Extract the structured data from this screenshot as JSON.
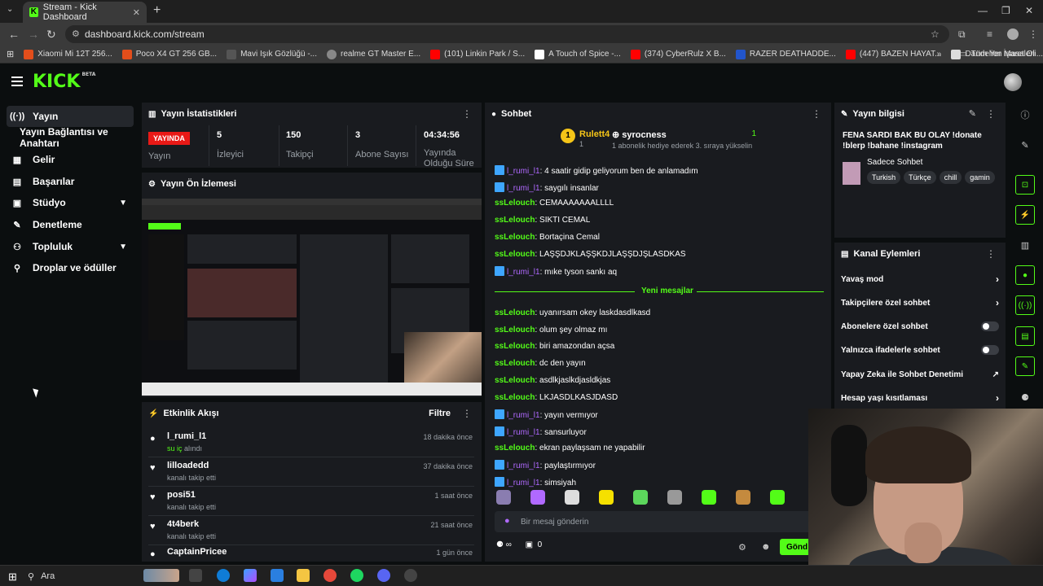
{
  "browser": {
    "tab_title": "Stream - Kick Dashboard",
    "url": "dashboard.kick.com/stream",
    "bookmarks": [
      {
        "label": "Xiaomi Mi 12T 256...",
        "color": "#e34e1b"
      },
      {
        "label": "Poco X4 GT 256 GB...",
        "color": "#e34e1b"
      },
      {
        "label": "Mavi Işık Gözlüğü -...",
        "color": "#555555"
      },
      {
        "label": "realme GT Master E...",
        "color": "#888888"
      },
      {
        "label": "(101) Linkin Park / S...",
        "color": "#ff0000"
      },
      {
        "label": "A Touch of Spice -...",
        "color": "#ffffff"
      },
      {
        "label": "(374) CyberRulz X B...",
        "color": "#ff0000"
      },
      {
        "label": "RAZER DEATHADDE...",
        "color": "#2255cc"
      },
      {
        "label": "(447) BAZEN HAYAT...",
        "color": "#ff0000"
      },
      {
        "label": "Dandelion Masa Oli...",
        "color": "#dddddd"
      }
    ],
    "bookmarks_folder": "Tüm Yer İşaretleri"
  },
  "sidebar": {
    "items": [
      {
        "label": "Yayın",
        "icon": "broadcast-icon"
      },
      {
        "label": "Yayın Bağlantısı ve Anahtarı",
        "icon": ""
      },
      {
        "label": "Gelir",
        "icon": "revenue-icon"
      },
      {
        "label": "Başarılar",
        "icon": "achievements-icon"
      },
      {
        "label": "Stüdyo",
        "icon": "studio-icon"
      },
      {
        "label": "Denetleme",
        "icon": "moderation-icon"
      },
      {
        "label": "Topluluk",
        "icon": "community-icon"
      },
      {
        "label": "Droplar ve ödüller",
        "icon": "drops-icon"
      }
    ]
  },
  "stats": {
    "title": "Yayın İstatistikleri",
    "live_label": "YAYINDA",
    "live_sub": "Yayın",
    "viewers": {
      "value": "5",
      "label": "İzleyici"
    },
    "followers": {
      "value": "150",
      "label": "Takipçi"
    },
    "subs": {
      "value": "3",
      "label": "Abone Sayısı"
    },
    "duration": {
      "value": "04:34:56",
      "label": "Yayında Olduğu Süre"
    }
  },
  "preview": {
    "title": "Yayın Ön İzlemesi"
  },
  "activity": {
    "title": "Etkinlik Akışı",
    "filter": "Filtre",
    "items": [
      {
        "name": "l_rumi_l1",
        "desc_green": "su iç",
        "desc": " alındı",
        "time": "18 dakika önce",
        "icon": "reward-icon"
      },
      {
        "name": "lilloadedd",
        "desc_green": "",
        "desc": "kanalı takip etti",
        "time": "37 dakika önce",
        "icon": "heart-icon"
      },
      {
        "name": "posi51",
        "desc_green": "",
        "desc": "kanalı takip etti",
        "time": "1 saat önce",
        "icon": "heart-icon"
      },
      {
        "name": "4t4berk",
        "desc_green": "",
        "desc": "kanalı takip etti",
        "time": "21 saat önce",
        "icon": "heart-icon"
      },
      {
        "name": "CaptainPricee",
        "desc_green": "",
        "desc": "",
        "time": "1 gün önce",
        "icon": "reward-icon"
      }
    ]
  },
  "chat": {
    "title": "Sohbet",
    "pinned": {
      "rank": "1",
      "user1": "Rulett4",
      "user1_count": "1",
      "user2": "syrocness",
      "user2_count": "1",
      "user2_desc": "1 abonelik hediye ederek 3. sıraya yükselin"
    },
    "messages": [
      {
        "user": "l_rumi_l1",
        "text": ": 4 saatir gidip geliyorum ben de anlamadım",
        "type": "u1"
      },
      {
        "user": "l_rumi_l1",
        "text": ": saygılı insanlar",
        "type": "u1"
      },
      {
        "user": "ssLelouch",
        "text": ": CEMAAAAAAALLLL",
        "type": "u2"
      },
      {
        "user": "ssLelouch",
        "text": ": SIKTI CEMAL",
        "type": "u2"
      },
      {
        "user": "ssLelouch",
        "text": ": Bortaçina Cemal",
        "type": "u2"
      },
      {
        "user": "ssLelouch",
        "text": ": LAŞŞDJKLAŞŞKDJLAŞŞDJŞLASDKAS",
        "type": "u2"
      },
      {
        "user": "l_rumi_l1",
        "text": ": mıke tyson sankı aq",
        "type": "u1"
      }
    ],
    "new_messages_label": "Yeni mesajlar",
    "messages2": [
      {
        "user": "ssLelouch",
        "text": ": uyanırsam okey laskdasdlkasd",
        "type": "u2"
      },
      {
        "user": "ssLelouch",
        "text": ": olum şey olmaz mı",
        "type": "u2"
      },
      {
        "user": "ssLelouch",
        "text": ": biri amazondan açsa",
        "type": "u2"
      },
      {
        "user": "ssLelouch",
        "text": ": dc den yayın",
        "type": "u2"
      },
      {
        "user": "ssLelouch",
        "text": ": asdlkjaslkdjasldkjas",
        "type": "u2"
      },
      {
        "user": "ssLelouch",
        "text": ": LKJASDLKASJDASD",
        "type": "u2"
      },
      {
        "user": "l_rumi_l1",
        "text": ": yayın vermıyor",
        "type": "u1"
      },
      {
        "user": "l_rumi_l1",
        "text": ": sansurluyor",
        "type": "u1"
      },
      {
        "user": "ssLelouch",
        "text": ": ekran paylaşsam ne yapabilir",
        "type": "u2"
      },
      {
        "user": "l_rumi_l1",
        "text": ": paylaştırmıyor",
        "type": "u1"
      },
      {
        "user": "l_rumi_l1",
        "text": ": simsiyah",
        "type": "u1"
      }
    ],
    "input_placeholder": "Bir mesaj gönderin",
    "points_infinite": "∞",
    "gift_count": "0",
    "send_label": "Gönd"
  },
  "stream_info": {
    "title_label": "Yayın bilgisi",
    "stream_title": "FENA SARDI BAK BU OLAY !donate !blerp !bahane !instagram",
    "category": "Sadece Sohbet",
    "tags": [
      "Turkish",
      "Türkçe",
      "chill",
      "gamin"
    ]
  },
  "channel_actions": {
    "title": "Kanal Eylemleri",
    "items": [
      {
        "label": "Yavaş mod",
        "control": "arrow"
      },
      {
        "label": "Takipçilere özel sohbet",
        "control": "arrow"
      },
      {
        "label": "Abonelere özel sohbet",
        "control": "toggle"
      },
      {
        "label": "Yalnızca ifadelerle sohbet",
        "control": "toggle"
      },
      {
        "label": "Yapay Zeka ile Sohbet Denetimi",
        "control": "external"
      },
      {
        "label": "Hesap yaşı kısıtlaması",
        "control": "arrow"
      }
    ]
  },
  "taskbar": {
    "search_label": "Ara"
  },
  "colors": {
    "accent": "#53fc18",
    "live": "#e91916",
    "panel": "#191b1f"
  }
}
